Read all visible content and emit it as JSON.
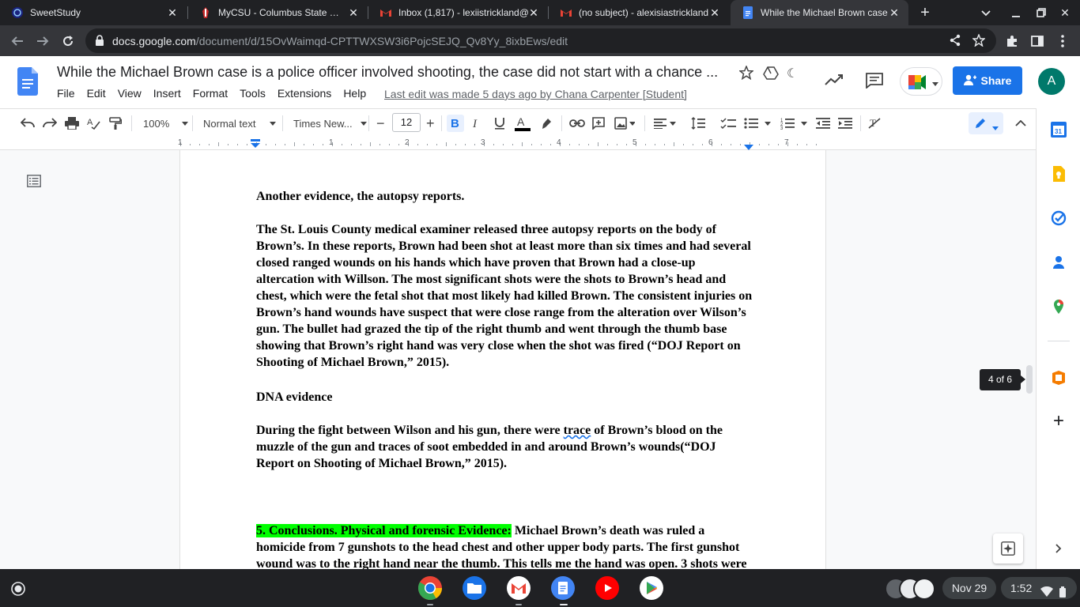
{
  "browser": {
    "tabs": [
      {
        "title": "SweetStudy",
        "icon": "sweetstudy-icon"
      },
      {
        "title": "MyCSU - Columbus State Univ",
        "icon": "csu-icon"
      },
      {
        "title": "Inbox (1,817) - lexiistrickland@",
        "icon": "gmail-icon"
      },
      {
        "title": "(no subject) - alexisiastrickland",
        "icon": "gmail-icon"
      },
      {
        "title": "While the Michael Brown case",
        "icon": "docs-icon"
      }
    ],
    "url_host": "docs.google.com",
    "url_path": "/document/d/15OvWaimqd-CPTTWXSW3i6PojcSEJQ_Qv8Yy_8ixbEws/edit"
  },
  "docs": {
    "title": "While the Michael Brown case is a police officer involved shooting, the case did not start with a chance ...",
    "menu": [
      "File",
      "Edit",
      "View",
      "Insert",
      "Format",
      "Tools",
      "Extensions",
      "Help"
    ],
    "last_edit": "Last edit was made 5 days ago by Chana Carpenter [Student]",
    "share_label": "Share",
    "avatar_letter": "A",
    "toolbar": {
      "zoom": "100%",
      "style": "Normal text",
      "font": "Times New...",
      "font_size": "12"
    },
    "ruler_numbers": [
      "1",
      "1",
      "2",
      "3",
      "4",
      "5",
      "6",
      "7"
    ],
    "page_indicator": "4 of 6",
    "body": {
      "h_autopsy": "Another evidence, the autopsy reports.",
      "p_autopsy": "The St. Louis County medical examiner released three autopsy reports on the body of Brown’s. In these reports, Brown had been shot at least more than six times and had several closed ranged wounds on his hands which have proven that Brown had a close-up altercation with Willson. The most significant shots were the shots to Brown’s head and chest, which were the fetal shot that most likely had killed Brown. The consistent injuries on Brown’s hand wounds have suspect that were close range from the alteration over Wilson’s gun. The bullet had grazed the tip of the right thumb and went through the thumb base showing that Brown’s right hand was very close when the shot was fired (“DOJ Report on Shooting of Michael Brown,” 2015).",
      "h_dna": "DNA evidence",
      "p_dna_a": "During the fight between Wilson and his gun, there were ",
      "p_dna_spell": "trace",
      "p_dna_b": " of Brown’s blood on the muzzle of the gun and traces of soot embedded in and around Brown’s wounds(“DOJ Report on Shooting of Michael Brown,” 2015).",
      "conclusion_highlight": "5. Conclusions. Physical and forensic Evidence:",
      "conclusion_text": " Michael Brown’s death was ruled a homicide from 7 gunshots to the head chest and other upper body parts. The first gunshot wound was to the right hand near the thumb. This tells me the hand was open. 3 shots were"
    }
  },
  "shelf": {
    "date": "Nov 29",
    "time": "1:52"
  },
  "colors": {
    "share": "#1a73e8",
    "highlight": "#00ff00",
    "avatar": "#00796b"
  }
}
